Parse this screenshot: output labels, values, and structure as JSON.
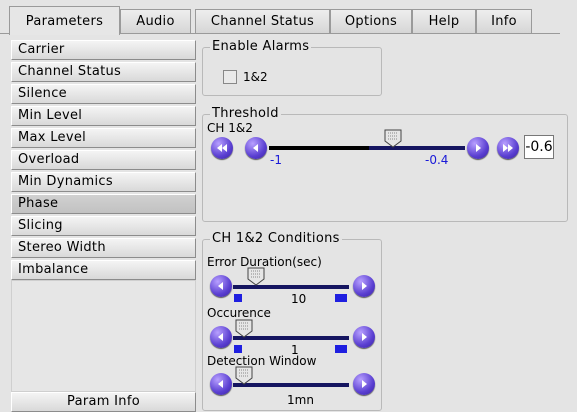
{
  "tabs": [
    {
      "label": "Parameters",
      "active": true
    },
    {
      "label": "Audio",
      "active": false
    },
    {
      "label": "Channel Status",
      "active": false
    },
    {
      "label": "Options",
      "active": false
    },
    {
      "label": "Help",
      "active": false
    },
    {
      "label": "Info",
      "active": false
    }
  ],
  "sidebar": {
    "items": [
      {
        "label": "Carrier"
      },
      {
        "label": "Channel Status"
      },
      {
        "label": "Silence"
      },
      {
        "label": "Min Level"
      },
      {
        "label": "Max Level"
      },
      {
        "label": "Overload"
      },
      {
        "label": "Min Dynamics"
      },
      {
        "label": "Phase",
        "selected": true
      },
      {
        "label": "Slicing"
      },
      {
        "label": "Stereo Width"
      },
      {
        "label": "Imbalance"
      }
    ],
    "bottom_button": "Param Info"
  },
  "enable_alarms": {
    "title": "Enable Alarms",
    "checkbox_label": "1&2",
    "checked": false
  },
  "threshold": {
    "title": "Threshold",
    "channel_label": "CH 1&2",
    "min_label": "-1",
    "max_label": "-0.4",
    "value": "-0.6"
  },
  "conditions": {
    "title": "CH 1&2 Conditions",
    "sliders": [
      {
        "label": "Error Duration(sec)",
        "value": "10"
      },
      {
        "label": "Occurence",
        "value": "1"
      },
      {
        "label": "Detection Window",
        "value": "1mn"
      }
    ]
  },
  "colors": {
    "accent": "#5a3fd1",
    "track": "#151560",
    "tick": "#1f1fe0",
    "value_text": "#1a1ad8"
  }
}
